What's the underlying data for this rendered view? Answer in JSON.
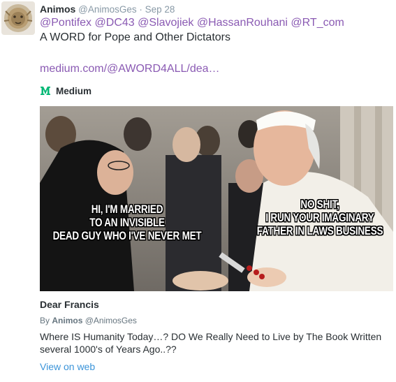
{
  "tweet": {
    "author_name": "Animos",
    "author_handle": "@AnimosGes",
    "separator": "·",
    "date": "Sep 28",
    "mentions": [
      "@Pontifex",
      "@DC43",
      "@Slavojiek",
      "@HassanRouhani",
      "@RT_com"
    ],
    "text": "A WORD for Pope and Other Dictators",
    "link": "medium.com/@AWORD4ALL/dea…",
    "colors": {
      "mention": "#8a5ab3",
      "link": "#8a5ab3",
      "muted": "#8899a6"
    }
  },
  "card": {
    "provider_icon": "medium-icon",
    "provider_name": "Medium",
    "image_caption_left": [
      "HI, I'M MARRIED",
      "TO AN INVISIBLE",
      "DEAD GUY WHO I'VE NEVER MET"
    ],
    "image_caption_right": [
      "NO SHIT,",
      "I RUN YOUR IMAGINARY",
      "FATHER IN LAWS BUSINESS"
    ],
    "title": "Dear Francis",
    "by_prefix": "By",
    "by_author": "Animos",
    "by_handle": "@AnimosGes",
    "description": "Where IS Humanity Today…? DO We Really Need to Live by The Book Written several 1000's of Years Ago..??",
    "view_link": "View on web",
    "colors": {
      "view_link": "#3b94d9",
      "medium_green": "#02b875"
    }
  }
}
